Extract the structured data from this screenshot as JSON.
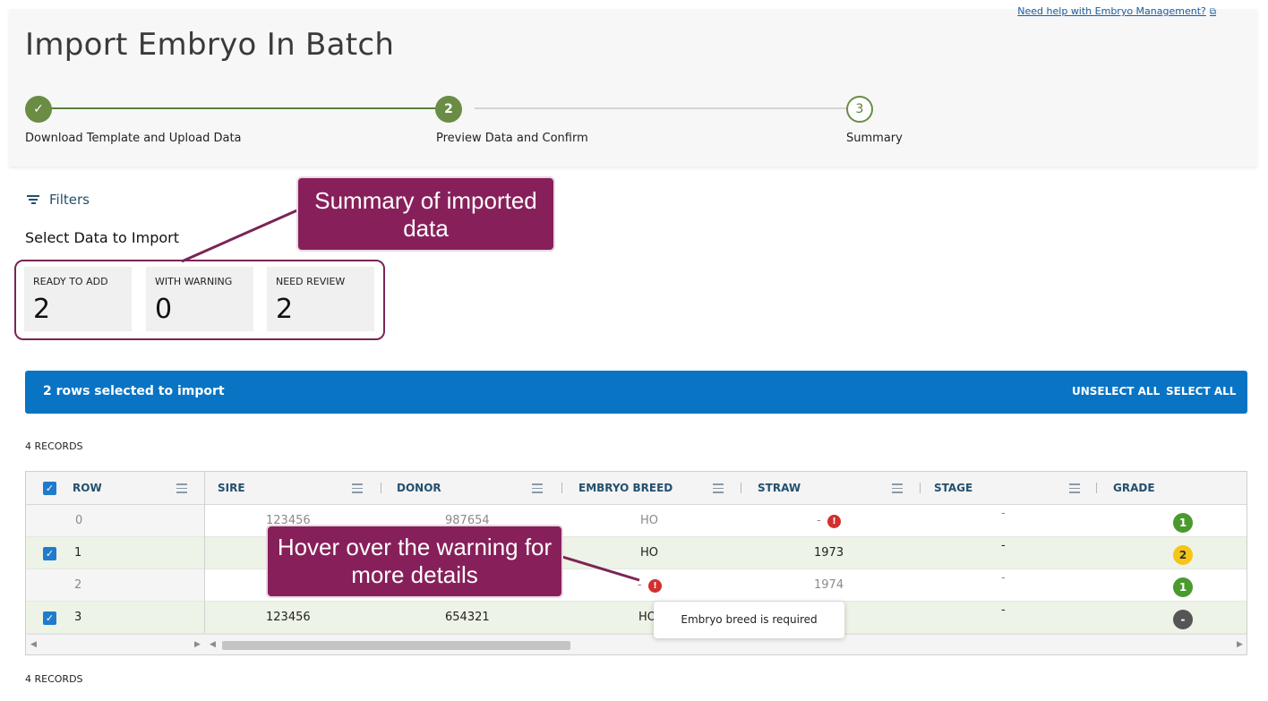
{
  "header": {
    "help_link": "Need help with Embryo Management?",
    "title": "Import Embryo In Batch"
  },
  "stepper": {
    "steps": [
      {
        "marker": "✓",
        "label": "Download Template and Upload Data"
      },
      {
        "marker": "2",
        "label": "Preview Data and Confirm"
      },
      {
        "marker": "3",
        "label": "Summary"
      }
    ]
  },
  "filters_label": "Filters",
  "section_title": "Select Data to Import",
  "summary": {
    "cards": [
      {
        "label": "READY TO ADD",
        "value": "2"
      },
      {
        "label": "WITH WARNING",
        "value": "0"
      },
      {
        "label": "NEED REVIEW",
        "value": "2"
      }
    ]
  },
  "callouts": {
    "summary": "Summary of imported data",
    "hover": "Hover over the warning for more details"
  },
  "selection_bar": {
    "text": "2 rows selected to import",
    "unselect_all": "UNSELECT ALL",
    "select_all": "SELECT ALL"
  },
  "records_label": "4 RECORDS",
  "grid": {
    "columns": [
      "ROW",
      "SIRE",
      "DONOR",
      "EMBRYO BREED",
      "STRAW",
      "STAGE",
      "GRADE"
    ],
    "rows": [
      {
        "row": "0",
        "sire": "123456",
        "donor": "987654",
        "breed": "HO",
        "straw": "-",
        "stage": "-",
        "grade": "1",
        "grade_color": "#4a9a2e",
        "selected": false
      },
      {
        "row": "1",
        "sire": "",
        "donor": "",
        "breed": "HO",
        "straw": "1973",
        "stage": "-",
        "grade": "2",
        "grade_color": "#f5c518",
        "selected": true
      },
      {
        "row": "2",
        "sire": "",
        "donor": "",
        "breed": "-",
        "straw": "1974",
        "stage": "-",
        "grade": "1",
        "grade_color": "#4a9a2e",
        "selected": false
      },
      {
        "row": "3",
        "sire": "123456",
        "donor": "654321",
        "breed": "HO",
        "straw": "",
        "stage": "-",
        "grade": "-",
        "grade_color": "#555555",
        "selected": true
      }
    ]
  },
  "tooltip": "Embryo breed is required",
  "colors": {
    "brand_green": "#6a8c45",
    "selection_blue": "#0a74c4",
    "callout": "#87205a",
    "warning_red": "#d32f2f"
  }
}
